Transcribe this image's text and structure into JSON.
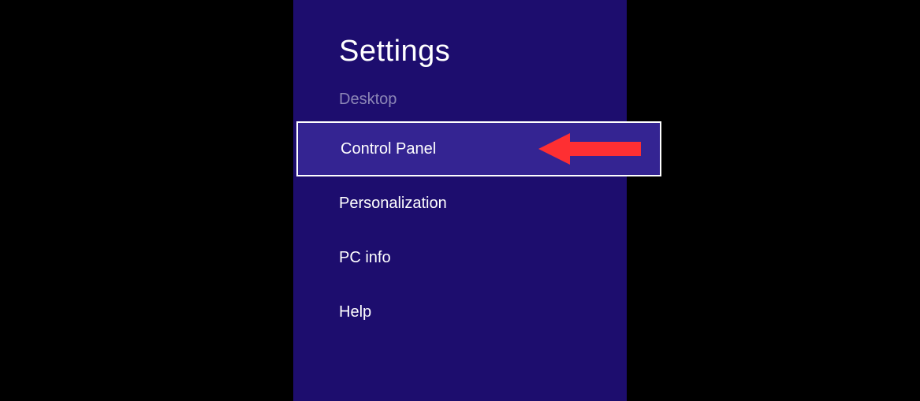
{
  "panel": {
    "title": "Settings",
    "subheading": "Desktop"
  },
  "menu": {
    "items": [
      {
        "label": "Control Panel",
        "highlighted": true
      },
      {
        "label": "Personalization",
        "highlighted": false
      },
      {
        "label": "PC info",
        "highlighted": false
      },
      {
        "label": "Help",
        "highlighted": false
      }
    ]
  },
  "annotation": {
    "arrow_color": "#fe2f32"
  }
}
